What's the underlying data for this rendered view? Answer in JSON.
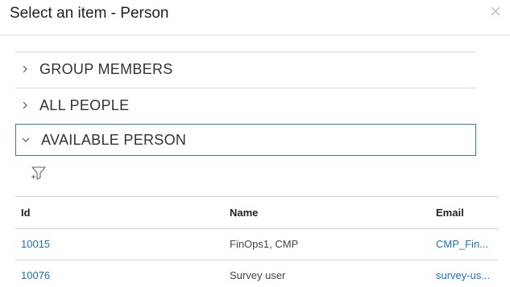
{
  "dialog": {
    "title": "Select an item - Person",
    "close_icon": "close-icon"
  },
  "accordion": {
    "sections": [
      {
        "label": "GROUP MEMBERS",
        "expanded": false
      },
      {
        "label": "ALL PEOPLE",
        "expanded": false
      },
      {
        "label": "AVAILABLE PERSON",
        "expanded": true
      }
    ]
  },
  "toolbar": {
    "filter_icon": "filter-icon"
  },
  "table": {
    "columns": [
      "Id",
      "Name",
      "Email"
    ],
    "rows": [
      {
        "id": "10015",
        "name": "FinOps1, CMP",
        "email": "CMP_Fin..."
      },
      {
        "id": "10076",
        "name": "Survey user",
        "email": "survey-us..."
      }
    ]
  },
  "colors": {
    "link": "#1a75b4",
    "expanded_border": "#2f7fb5",
    "divider": "#d6d6d6"
  }
}
